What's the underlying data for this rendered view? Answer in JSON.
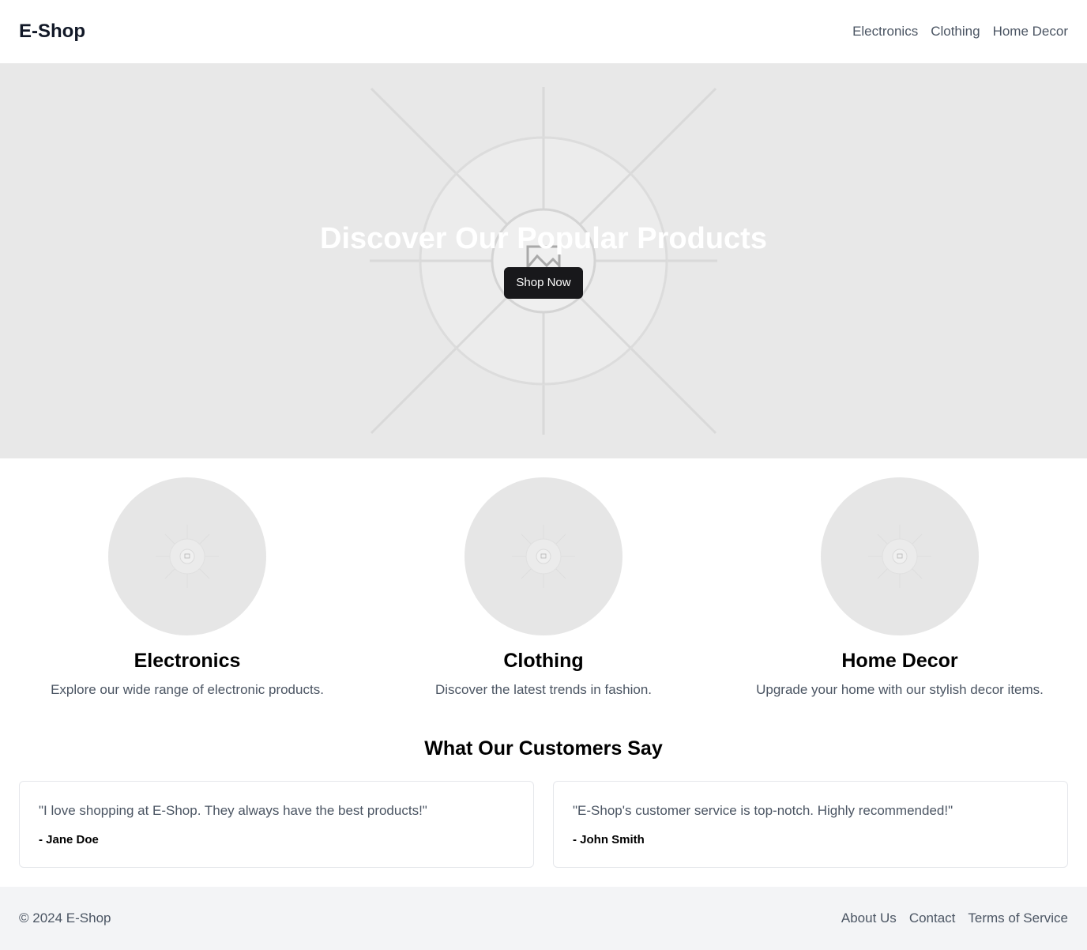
{
  "header": {
    "logo": "E-Shop",
    "nav": [
      "Electronics",
      "Clothing",
      "Home Decor"
    ]
  },
  "hero": {
    "title": "Discover Our Popular Products",
    "button": "Shop Now"
  },
  "categories": [
    {
      "title": "Electronics",
      "description": "Explore our wide range of electronic products."
    },
    {
      "title": "Clothing",
      "description": "Discover the latest trends in fashion."
    },
    {
      "title": "Home Decor",
      "description": "Upgrade your home with our stylish decor items."
    }
  ],
  "testimonials": {
    "title": "What Our Customers Say",
    "items": [
      {
        "quote": "\"I love shopping at E-Shop. They always have the best products!\"",
        "author": "- Jane Doe"
      },
      {
        "quote": "\"E-Shop's customer service is top-notch. Highly recommended!\"",
        "author": "- John Smith"
      }
    ]
  },
  "footer": {
    "copyright": "© 2024 E-Shop",
    "links": [
      "About Us",
      "Contact",
      "Terms of Service"
    ]
  },
  "colors": {
    "button_bg": "#18181b",
    "placeholder_bg": "#e8e8e8",
    "footer_bg": "#f3f4f6",
    "muted_text": "#4b5563"
  }
}
